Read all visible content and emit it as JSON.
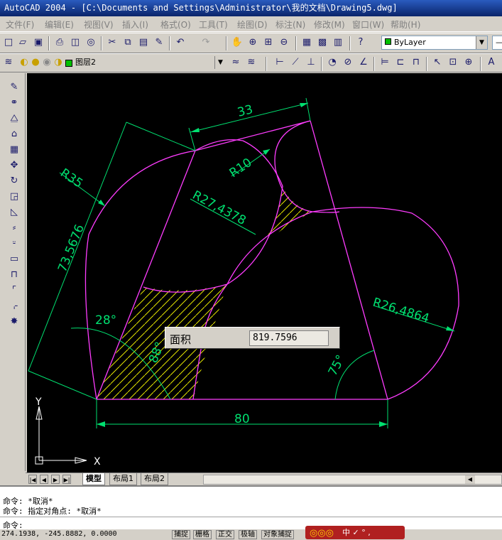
{
  "window": {
    "title": "AutoCAD 2004 - [C:\\Documents and Settings\\Administrator\\我的文档\\Drawing5.dwg]"
  },
  "menu": {
    "items": [
      "文件(F)",
      "编辑(E)",
      "视图(V)",
      "插入(I)",
      "格式(O)",
      "工具(T)",
      "绘图(D)",
      "标注(N)",
      "修改(M)",
      "窗口(W)",
      "帮助(H)"
    ]
  },
  "toolbar": {
    "color_combo": "ByLayer",
    "layer_combo": "图层2"
  },
  "drawing": {
    "dimensions": {
      "d33": "33",
      "r10": "R10",
      "r35": "R35",
      "r27": "R27,4378",
      "len73": "73,5676",
      "r26": "R26,4864",
      "a28": "28°",
      "a88": "88°",
      "a75": "75°",
      "d80": "80"
    },
    "ucs": {
      "x": "X",
      "y": "Y"
    }
  },
  "tooltip": {
    "label": "面积",
    "value": "819.7596"
  },
  "tabs": [
    "模型",
    "布局1",
    "布局2"
  ],
  "command": {
    "lines": [
      "命令: *取消*",
      "命令: 指定对角点: *取消*",
      "命令:"
    ]
  },
  "status": {
    "coords": "274.1938, -245.8882, 0.0000",
    "buttons": [
      "捕捉",
      "栅格",
      "正交",
      "极轴",
      "对象捕捉"
    ]
  },
  "ime": {
    "text": "中 ✓ ° ,"
  }
}
